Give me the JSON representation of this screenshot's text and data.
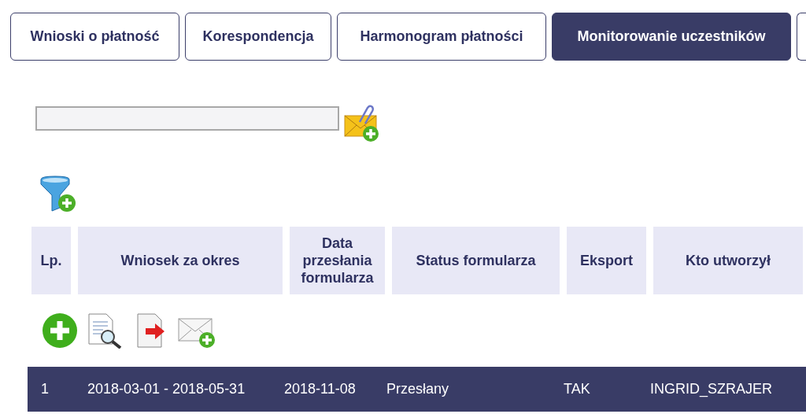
{
  "tabs": [
    {
      "label": "Wnioski o płatność",
      "selected": false
    },
    {
      "label": "Korespondencja",
      "selected": false
    },
    {
      "label": "Harmonogram płatności",
      "selected": false
    },
    {
      "label": "Monitorowanie uczestników",
      "selected": true
    }
  ],
  "table": {
    "columns": [
      "Lp.",
      "Wniosek za okres",
      "Data przesłania formularza",
      "Status formularza",
      "Eksport",
      "Kto utworzył"
    ],
    "rows": [
      {
        "selected": true,
        "cells": [
          "1",
          "2018-03-01 - 2018-05-31",
          "2018-11-08",
          "Przesłany",
          "TAK",
          "INGRID_SZRAJER"
        ]
      }
    ]
  }
}
